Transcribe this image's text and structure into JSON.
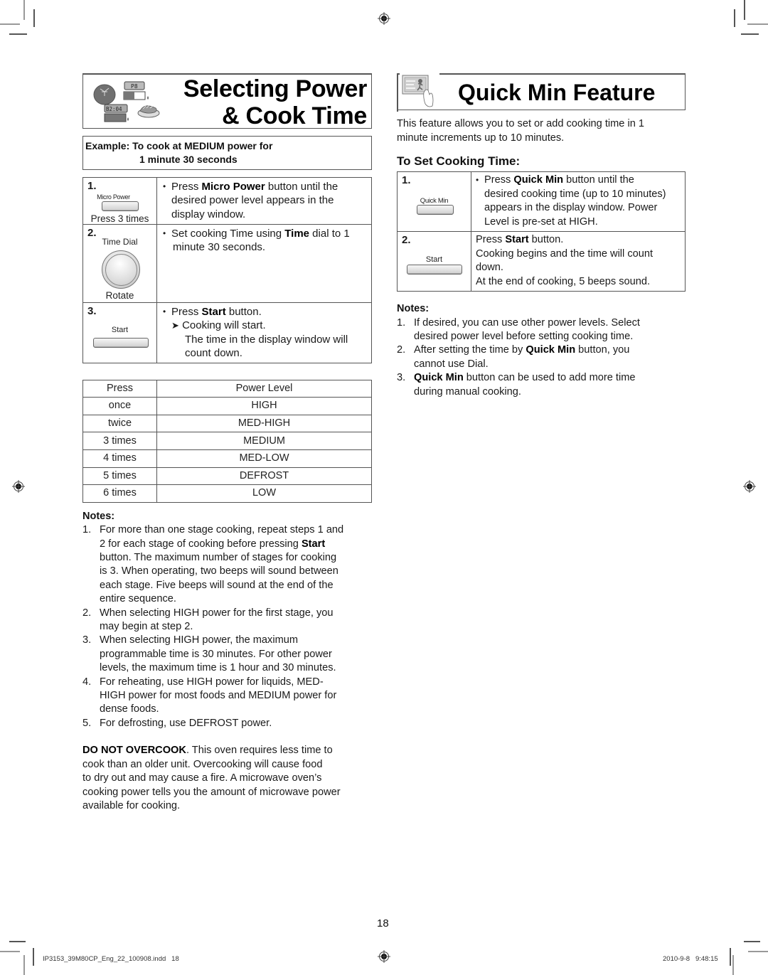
{
  "left": {
    "title_line1": "Selecting Power",
    "title_line2": "& Cook Time",
    "example_line1": "Example: To cook at MEDIUM power for",
    "example_line2": "1 minute 30 seconds",
    "steps": [
      {
        "num": "1.",
        "button_label": "Micro Power",
        "caption": "Press 3 times",
        "text_pre": "Press ",
        "text_bold": "Micro Power",
        "text_post": " button until the",
        "line2": "desired power level appears in the",
        "line3": "display window."
      },
      {
        "num": "2.",
        "button_label": "Time Dial",
        "caption": "Rotate",
        "text_pre": "Set cooking Time using ",
        "text_bold": "Time",
        "text_post": " dial to 1",
        "line2": "minute 30 seconds."
      },
      {
        "num": "3.",
        "button_label": "Start",
        "text_pre": "Press ",
        "text_bold": "Start",
        "text_post": " button.",
        "arrow": "➤",
        "line2": "Cooking will start.",
        "line3": "The time in the display window will",
        "line4": "count down."
      }
    ],
    "power_table": {
      "headers": [
        "Press",
        "Power Level"
      ],
      "rows": [
        [
          "once",
          "HIGH"
        ],
        [
          "twice",
          "MED-HIGH"
        ],
        [
          "3 times",
          "MEDIUM"
        ],
        [
          "4 times",
          "MED-LOW"
        ],
        [
          "5 times",
          "DEFROST"
        ],
        [
          "6 times",
          "LOW"
        ]
      ]
    },
    "notes_title": "Notes:",
    "notes": [
      {
        "n": "1.",
        "lines": [
          "For more than one stage cooking, repeat steps 1 and",
          "2 for each stage of cooking before pressing ",
          "Start",
          "button. The maximum number of stages for cooking",
          "is 3. When operating, two beeps will sound between",
          "each stage. Five beeps will sound at the end of the",
          "entire sequence."
        ]
      },
      {
        "n": "2.",
        "lines": [
          "When selecting HIGH power for the first stage, you",
          "may begin at step 2."
        ]
      },
      {
        "n": "3.",
        "lines": [
          "When selecting HIGH power, the maximum",
          "programmable time is 30 minutes. For other power",
          "levels, the maximum time is 1 hour and 30 minutes."
        ]
      },
      {
        "n": "4.",
        "lines": [
          "For reheating, use HIGH power for liquids, MED-",
          "HIGH power for most foods and MEDIUM power for",
          "dense foods."
        ]
      },
      {
        "n": "5.",
        "lines": [
          "For defrosting, use DEFROST power."
        ]
      }
    ],
    "warning_bold": "DO NOT OVERCOOK",
    "warning_lines": [
      ". This oven requires less time to",
      "cook than an older unit. Overcooking will cause food",
      "to dry out and may cause a fire. A microwave oven’s",
      "cooking power tells you the amount of microwave power",
      "available for cooking."
    ]
  },
  "right": {
    "title": "Quick Min Feature",
    "intro_lines": [
      "This feature allows you to set or add cooking time in 1",
      "minute increments up to 10 minutes."
    ],
    "subtitle": "To Set Cooking Time:",
    "steps": [
      {
        "num": "1.",
        "button_label": "Quick Min",
        "text_pre": "Press ",
        "text_bold": "Quick Min",
        "text_post": " button until the",
        "line2": "desired cooking time (up to 10 minutes)",
        "line3": "appears in the display window. Power",
        "line4": "Level is pre-set at HIGH."
      },
      {
        "num": "2.",
        "button_label": "Start",
        "text_pre": "Press ",
        "text_bold": "Start",
        "text_post": " button.",
        "line2": "Cooking begins and the time will count",
        "line3": "down.",
        "line4": "At the end of cooking, 5 beeps sound."
      }
    ],
    "notes_title": "Notes:",
    "notes": [
      {
        "n": "1.",
        "l1": "If desired, you can use other power levels. Select",
        "l2": "desired power level before setting cooking time."
      },
      {
        "n": "2.",
        "l1_pre": "After setting the time by ",
        "l1_bold": "Quick Min",
        "l1_post": " button, you",
        "l2": "cannot use Dial."
      },
      {
        "n": "3.",
        "l1_bold": "Quick Min",
        "l1_post": " button can be used to add more time",
        "l2": "during manual cooking."
      }
    ]
  },
  "footer": {
    "page_number": "18",
    "slug_file": "IP3153_39M80CP_Eng_22_100908.indd   18",
    "slug_date": "2010-9-8   9:48:15"
  },
  "icons": {
    "title_icon": "food-display-icon",
    "quick_min_icon": "hand-pressing-button-icon",
    "registration_mark": "registration-crosshair-icon"
  }
}
